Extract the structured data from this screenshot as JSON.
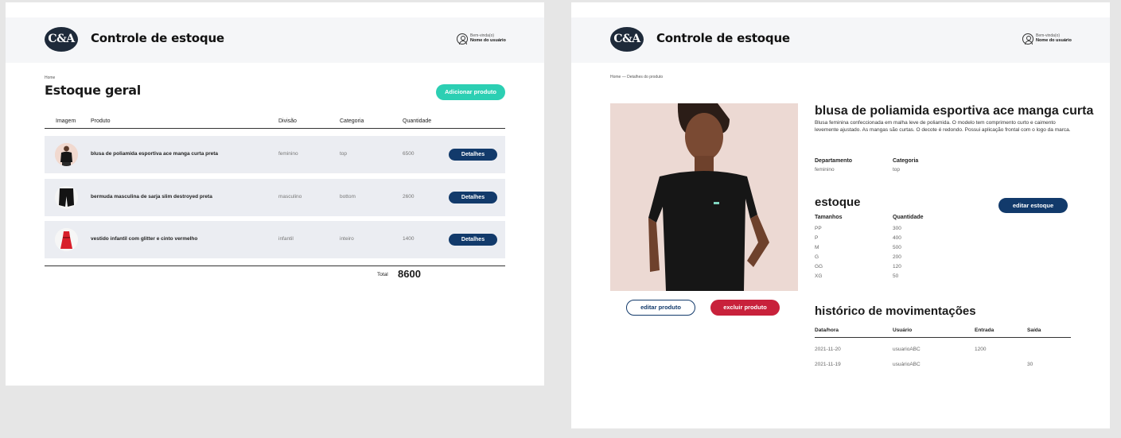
{
  "app": {
    "brand_logo": "C&A",
    "title": "Controle de estoque",
    "user_greeting": "Bem-vinda(o)",
    "user_name": "Nome do usuário"
  },
  "stock_page": {
    "breadcrumb": "Home",
    "title": "Estoque geral",
    "add_button": "Adicionar produto",
    "columns": [
      "Imagem",
      "Produto",
      "Divisão",
      "Categoria",
      "Quantidade"
    ],
    "rows": [
      {
        "product": "blusa de poliamida esportiva ace manga curta preta",
        "division": "feminino",
        "category": "top",
        "quantity": "6500",
        "action": "Detalhes"
      },
      {
        "product": "bermuda masculina de sarja slim destroyed preta",
        "division": "masculino",
        "category": "bottom",
        "quantity": "2600",
        "action": "Detalhes"
      },
      {
        "product": "vestido infantil com glitter e cinto vermelho",
        "division": "infantil",
        "category": "inteiro",
        "quantity": "1400",
        "action": "Detalhes"
      }
    ],
    "total_label": "Total",
    "total_value": "8600"
  },
  "detail_page": {
    "breadcrumb": "Home  —  Detalhes do produto",
    "product_title": "blusa de poliamida esportiva ace manga curta",
    "description": "Blusa feminina confeccionada em malha leve de poliamida. O modelo tem comprimento curto e caimento levemente ajustado. As mangas são curtas. O decote é redondo. Possui aplicação frontal com o logo da marca.",
    "department_label": "Departamento",
    "department_value": "feminino",
    "category_label": "Categoria",
    "category_value": "top",
    "stock_title": "estoque",
    "edit_stock_button": "editar estoque",
    "sizes_label": "Tamanhos",
    "quantity_label": "Quantidade",
    "stock": [
      {
        "size": "PP",
        "qty": "300"
      },
      {
        "size": "P",
        "qty": "400"
      },
      {
        "size": "M",
        "qty": "500"
      },
      {
        "size": "G",
        "qty": "200"
      },
      {
        "size": "GG",
        "qty": "120"
      },
      {
        "size": "XG",
        "qty": "50"
      }
    ],
    "history_title": "histórico de movimentações",
    "history_columns": [
      "Data/hora",
      "Usuário",
      "Entrada",
      "Saída"
    ],
    "history": [
      {
        "date": "2021-11-20",
        "user": "usuarioABC",
        "in": "1200",
        "out": ""
      },
      {
        "date": "2021-11-19",
        "user": "usuárioABC",
        "in": "",
        "out": "30"
      }
    ],
    "edit_product_button": "editar produto",
    "delete_product_button": "excluir produto"
  },
  "colors": {
    "accent_teal": "#2ccfb3",
    "primary_navy": "#123a6b",
    "danger_red": "#c8213b",
    "row_bg": "#ebedf2",
    "header_bg": "#f5f6f8"
  }
}
